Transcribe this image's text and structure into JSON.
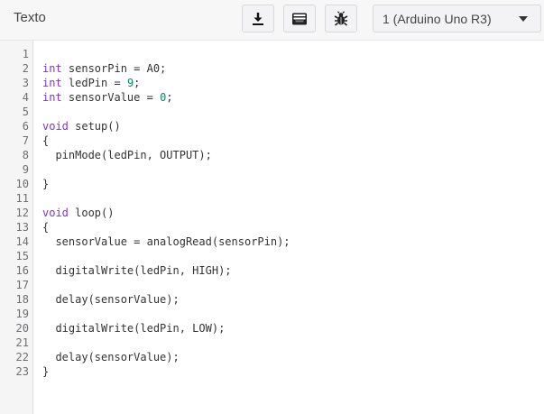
{
  "toolbar": {
    "mode_label": "Texto",
    "buttons": [
      {
        "name": "download-button",
        "icon": "download-icon"
      },
      {
        "name": "serial-monitor-button",
        "icon": "serial-monitor-icon"
      },
      {
        "name": "debug-button",
        "icon": "bug-icon"
      }
    ],
    "board_select": {
      "value": "1 (Arduino Uno R3)",
      "icon": "caret-down-icon"
    }
  },
  "editor": {
    "lines": [
      {
        "number": "1",
        "tokens": []
      },
      {
        "number": "2",
        "tokens": [
          {
            "t": "int",
            "k": "keyword"
          },
          {
            "t": " sensorPin = A0;",
            "k": "plain"
          }
        ]
      },
      {
        "number": "3",
        "tokens": [
          {
            "t": "int",
            "k": "keyword"
          },
          {
            "t": " ledPin = ",
            "k": "plain"
          },
          {
            "t": "9",
            "k": "number"
          },
          {
            "t": ";",
            "k": "plain"
          }
        ]
      },
      {
        "number": "4",
        "tokens": [
          {
            "t": "int",
            "k": "keyword"
          },
          {
            "t": " sensorValue = ",
            "k": "plain"
          },
          {
            "t": "0",
            "k": "number"
          },
          {
            "t": ";",
            "k": "plain"
          }
        ]
      },
      {
        "number": "5",
        "tokens": []
      },
      {
        "number": "6",
        "tokens": [
          {
            "t": "void",
            "k": "keyword"
          },
          {
            "t": " setup()",
            "k": "plain"
          }
        ]
      },
      {
        "number": "7",
        "tokens": [
          {
            "t": "{",
            "k": "plain"
          }
        ]
      },
      {
        "number": "8",
        "tokens": [
          {
            "t": "  pinMode(ledPin, OUTPUT);",
            "k": "plain"
          }
        ]
      },
      {
        "number": "9",
        "tokens": []
      },
      {
        "number": "10",
        "tokens": [
          {
            "t": "}",
            "k": "plain"
          }
        ]
      },
      {
        "number": "11",
        "tokens": []
      },
      {
        "number": "12",
        "tokens": [
          {
            "t": "void",
            "k": "keyword"
          },
          {
            "t": " loop()",
            "k": "plain"
          }
        ]
      },
      {
        "number": "13",
        "tokens": [
          {
            "t": "{",
            "k": "plain"
          }
        ]
      },
      {
        "number": "14",
        "tokens": [
          {
            "t": "  sensorValue = analogRead(sensorPin);",
            "k": "plain"
          }
        ]
      },
      {
        "number": "15",
        "tokens": []
      },
      {
        "number": "16",
        "tokens": [
          {
            "t": "  digitalWrite(ledPin, HIGH);",
            "k": "plain"
          }
        ]
      },
      {
        "number": "17",
        "tokens": []
      },
      {
        "number": "18",
        "tokens": [
          {
            "t": "  delay(sensorValue);",
            "k": "plain"
          }
        ]
      },
      {
        "number": "19",
        "tokens": []
      },
      {
        "number": "20",
        "tokens": [
          {
            "t": "  digitalWrite(ledPin, LOW);",
            "k": "plain"
          }
        ]
      },
      {
        "number": "21",
        "tokens": []
      },
      {
        "number": "22",
        "tokens": [
          {
            "t": "  delay(sensorValue);",
            "k": "plain"
          }
        ]
      },
      {
        "number": "23",
        "tokens": [
          {
            "t": "}",
            "k": "plain"
          }
        ]
      }
    ]
  },
  "colors": {
    "keyword": "#8a2be2",
    "number": "#0b8a60",
    "text": "#333333",
    "gutter_bg": "#f5f5f6",
    "toolbar_bg": "#f7f7f8"
  }
}
